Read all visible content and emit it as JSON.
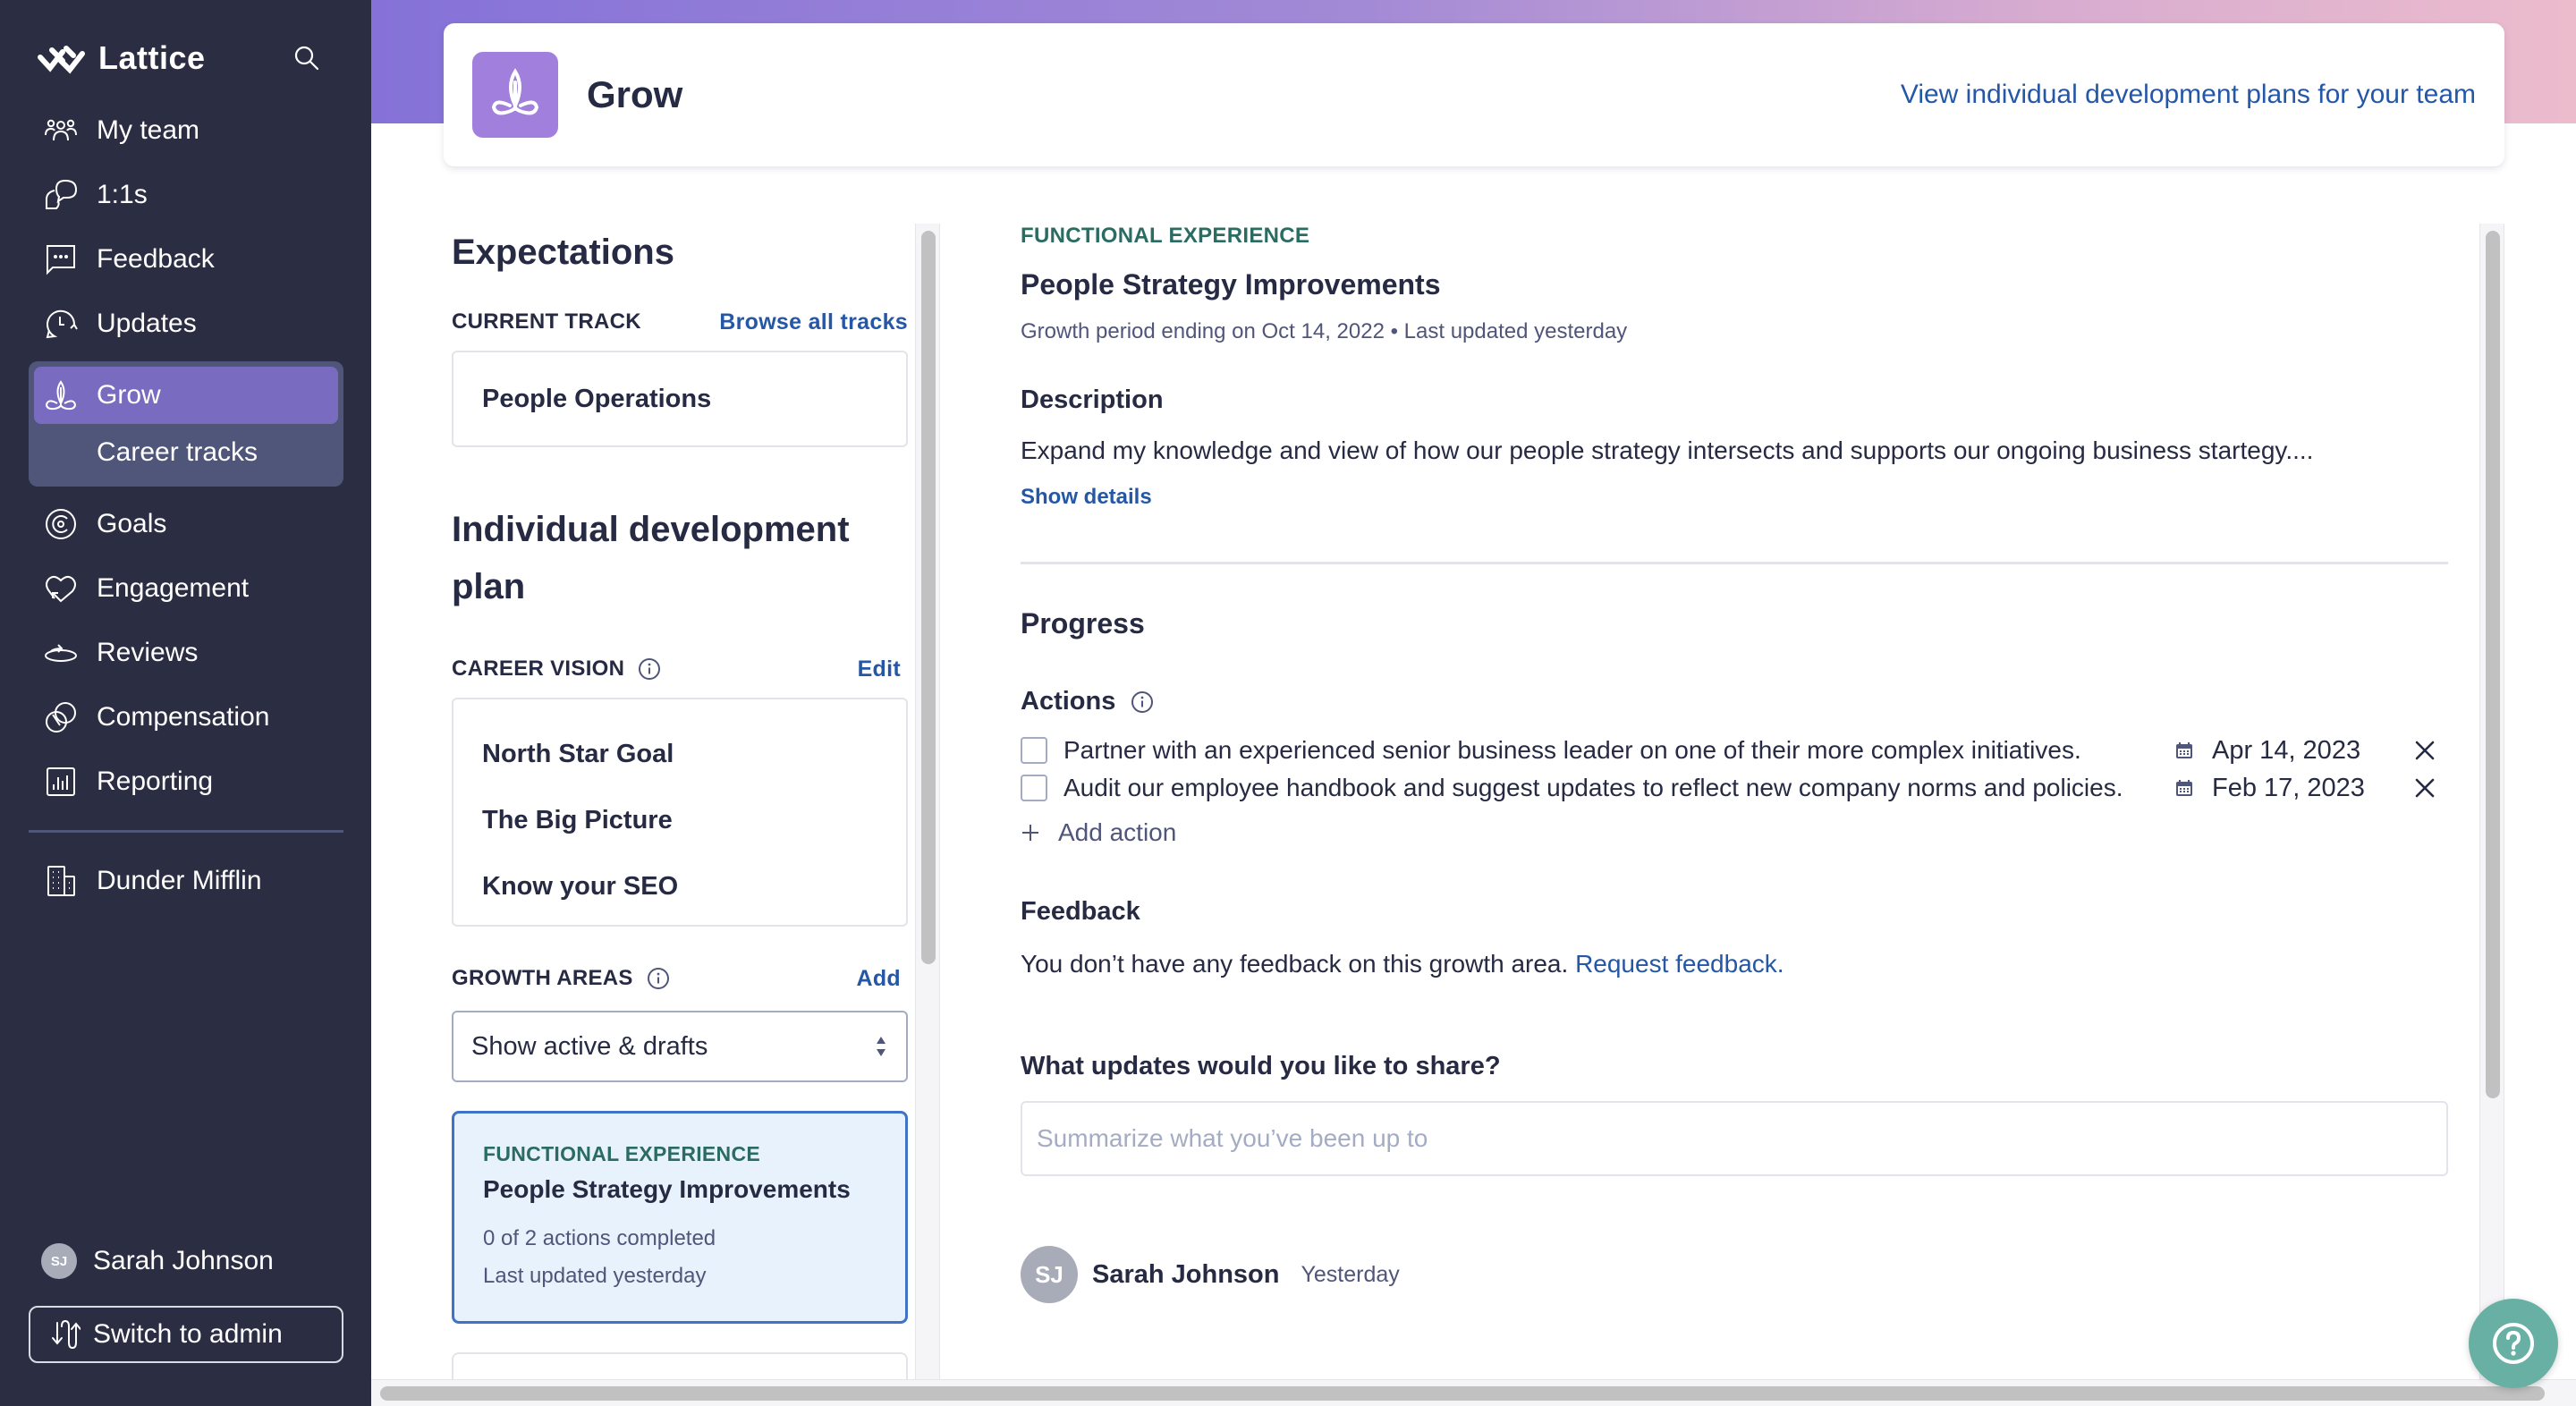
{
  "app": {
    "name": "Lattice"
  },
  "sidebar": {
    "items": [
      {
        "label": "My team",
        "icon": "team-icon"
      },
      {
        "label": "1:1s",
        "icon": "chat-bubbles-icon"
      },
      {
        "label": "Feedback",
        "icon": "feedback-icon"
      },
      {
        "label": "Updates",
        "icon": "updates-icon"
      }
    ],
    "grow_group": {
      "active": {
        "label": "Grow",
        "icon": "grow-icon"
      },
      "sub": {
        "label": "Career tracks"
      }
    },
    "items_after": [
      {
        "label": "Goals",
        "icon": "goals-icon"
      },
      {
        "label": "Engagement",
        "icon": "engagement-icon"
      },
      {
        "label": "Reviews",
        "icon": "reviews-icon"
      },
      {
        "label": "Compensation",
        "icon": "compensation-icon"
      },
      {
        "label": "Reporting",
        "icon": "reporting-icon"
      }
    ],
    "company": {
      "label": "Dunder Mifflin",
      "icon": "building-icon"
    },
    "user": {
      "initials": "SJ",
      "name": "Sarah Johnson"
    },
    "switch_admin_label": "Switch to admin"
  },
  "header": {
    "title": "Grow",
    "link": "View individual development plans for your team"
  },
  "expectations": {
    "title": "Expectations",
    "current_track_label": "CURRENT TRACK",
    "browse_link": "Browse all tracks",
    "current_track": "People Operations"
  },
  "idp": {
    "title": "Individual development plan",
    "career_vision_label": "CAREER VISION",
    "edit_link": "Edit",
    "vision_items": [
      "North Star Goal",
      "The Big Picture",
      "Know your SEO"
    ],
    "growth_areas_label": "GROWTH AREAS",
    "add_link": "Add",
    "filter_selected": "Show active & drafts",
    "growth_area_card": {
      "category": "FUNCTIONAL EXPERIENCE",
      "title": "People Strategy Improvements",
      "progress": "0 of 2 actions completed",
      "updated": "Last updated yesterday"
    }
  },
  "detail": {
    "category": "FUNCTIONAL EXPERIENCE",
    "title": "People Strategy Improvements",
    "meta": "Growth period ending on Oct 14, 2022 • Last updated yesterday",
    "more_label": "•••",
    "description_label": "Description",
    "description": "Expand my knowledge and view of how our people strategy intersects and supports our ongoing business startegy....",
    "show_details": "Show details",
    "progress_label": "Progress",
    "actions_label": "Actions",
    "actions": [
      {
        "text": "Partner with an experienced senior business leader on one of their more complex initiatives.",
        "due": "Apr 14, 2023",
        "completed": false
      },
      {
        "text": "Audit our employee handbook and suggest updates to reflect new company norms and policies.",
        "due": "Feb 17, 2023",
        "completed": false
      }
    ],
    "add_action": "Add action",
    "feedback_label": "Feedback",
    "feedback_text": "You don’t have any feedback on this growth area.",
    "request_feedback": "Request feedback.",
    "updates_label": "What updates would you like to share?",
    "updates_placeholder": "Summarize what you’ve been up to",
    "updates_value": "",
    "post": {
      "initials": "SJ",
      "author": "Sarah Johnson",
      "time": "Yesterday"
    }
  },
  "colors": {
    "sidebar_bg": "#2b2d42",
    "active_nav": "#786bc0",
    "link": "#2557a7",
    "category_green": "#2a6b62",
    "help_fab": "#68b0a4"
  }
}
